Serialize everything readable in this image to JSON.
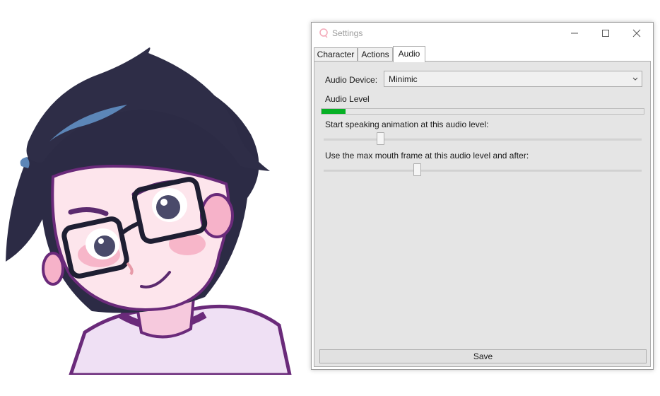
{
  "window": {
    "title": "Settings",
    "icon": "app-logo-icon",
    "controls": [
      "minimize-icon",
      "maximize-icon",
      "close-icon"
    ]
  },
  "tabs": [
    {
      "label": "Character",
      "active": false
    },
    {
      "label": "Actions",
      "active": false
    },
    {
      "label": "Audio",
      "active": true
    }
  ],
  "audio": {
    "device_label": "Audio Device:",
    "device_value": "Minimic",
    "level_label": "Audio Level",
    "level_value": 0.074,
    "level_color": "#06b025",
    "start_label": "Start speaking animation at this audio level:",
    "start_value": 0.18,
    "max_label": "Use the max mouth frame at this audio level and after:",
    "max_value": 0.295
  },
  "save_label": "Save",
  "avatar": {
    "description_icon": "avatar-illustration"
  }
}
